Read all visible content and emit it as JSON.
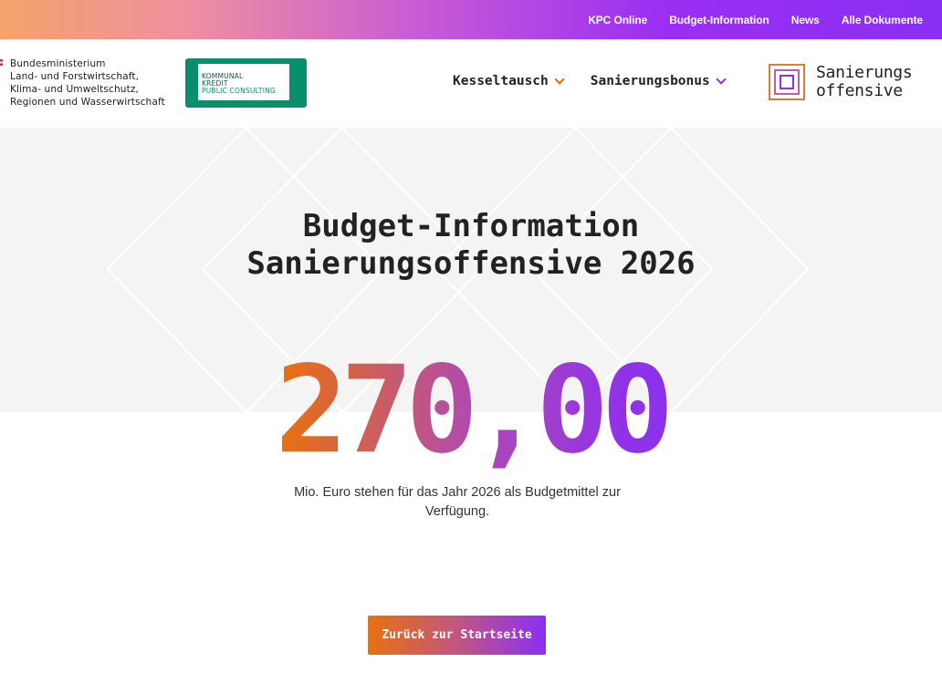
{
  "topnav": {
    "items": [
      "KPC Online",
      "Budget-Information",
      "News",
      "Alle Dokumente"
    ]
  },
  "header": {
    "ministry_lines": [
      "Bundesministerium",
      "Land- und Forstwirtschaft,",
      "Klima- und Umweltschutz,",
      "Regionen und Wasserwirtschaft"
    ],
    "kpc_lines": [
      "KOMMUNAL",
      "KREDIT",
      "PUBLIC CONSULTING"
    ],
    "nav": [
      {
        "label": "Kesseltausch",
        "chevron": "chevron-down-icon",
        "color": "#e2671a"
      },
      {
        "label": "Sanierungsbonus",
        "chevron": "chevron-down-icon",
        "color": "#8a2ff5"
      }
    ],
    "brand_lines": [
      "Sanierungs",
      "offensive"
    ]
  },
  "hero": {
    "title_lines": [
      "Budget-Information",
      "Sanierungsoffensive 2026"
    ]
  },
  "budget": {
    "amount": "270,00",
    "description": "Mio. Euro stehen für das Jahr 2026 als Budgetmit­tel zur Verfügung."
  },
  "back_button": {
    "label": "Zurück zur Startseite"
  },
  "colors": {
    "orange": "#e8700f",
    "purple": "#8a2ff5",
    "kpc_green": "#0a8f6c"
  }
}
